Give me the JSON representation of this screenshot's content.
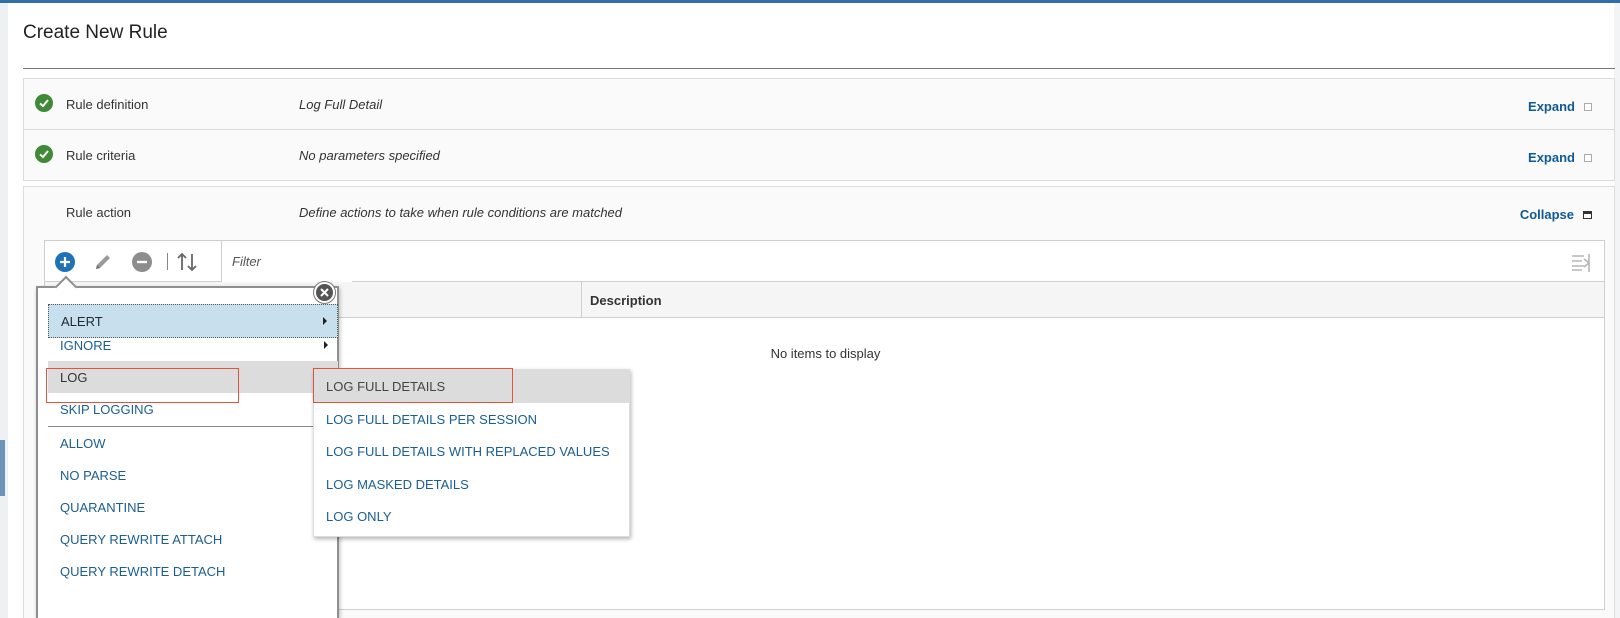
{
  "page": {
    "title": "Create New Rule"
  },
  "sections": [
    {
      "name": "Rule definition",
      "summary": "Log Full Detail",
      "toggle": "Expand"
    },
    {
      "name": "Rule criteria",
      "summary": "No parameters specified",
      "toggle": "Expand"
    }
  ],
  "action": {
    "name": "Rule action",
    "summary": "Define actions to take when rule conditions are matched",
    "toggle": "Collapse"
  },
  "grid": {
    "filter_placeholder": "Filter",
    "columns": [
      "",
      "Description"
    ],
    "empty_message": "No items to display"
  },
  "menu": {
    "items": [
      {
        "label": "ALERT",
        "has_submenu": true
      },
      {
        "label": "IGNORE",
        "has_submenu": true
      },
      {
        "label": "LOG",
        "has_submenu": true
      },
      {
        "label": "SKIP LOGGING",
        "has_submenu": false
      },
      {
        "label": "ALLOW",
        "has_submenu": false
      },
      {
        "label": "NO PARSE",
        "has_submenu": false
      },
      {
        "label": "QUARANTINE",
        "has_submenu": false
      },
      {
        "label": "QUERY REWRITE ATTACH",
        "has_submenu": false
      },
      {
        "label": "QUERY REWRITE DETACH",
        "has_submenu": false
      }
    ],
    "submenu": [
      {
        "label": "LOG FULL DETAILS"
      },
      {
        "label": "LOG FULL DETAILS PER SESSION"
      },
      {
        "label": "LOG FULL DETAILS WITH REPLACED VALUES"
      },
      {
        "label": "LOG MASKED DETAILS"
      },
      {
        "label": "LOG ONLY"
      }
    ]
  },
  "icons": {
    "add": "plus-circle-icon",
    "edit": "pencil-icon",
    "remove": "minus-circle-icon",
    "sort": "sort-arrows-icon",
    "columns": "column-settings-icon",
    "close": "close-circle-icon",
    "check": "check-circle-icon"
  },
  "colors": {
    "accent": "#1f72b8",
    "link": "#1a5e93",
    "success": "#3f8a36",
    "highlight_box": "#e2533a",
    "selected_menu": "#c8dfee"
  }
}
